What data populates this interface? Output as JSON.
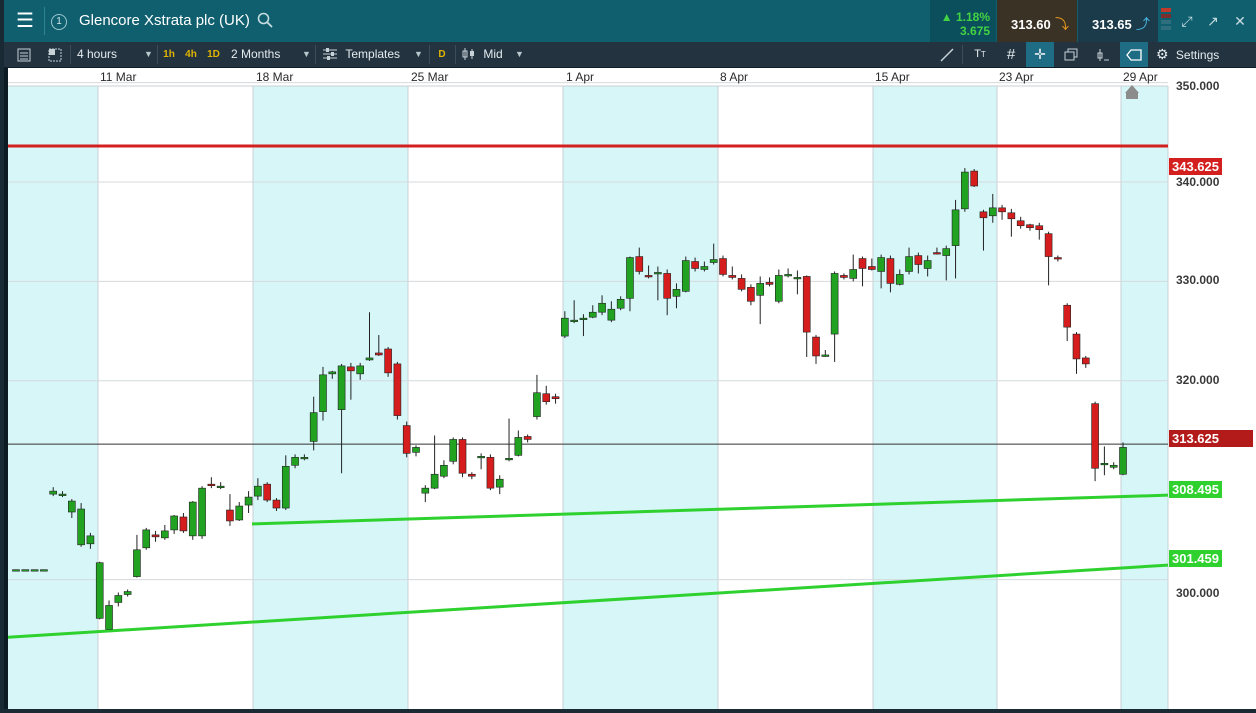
{
  "header": {
    "instrument": "Glencore Xstrata plc (UK)",
    "change_pct": "1.18%",
    "change_abs": "3.675",
    "sell_price": "313.60",
    "buy_price": "313.65",
    "info_badge": "1"
  },
  "toolbar": {
    "interval": "4 hours",
    "tf_1h": "1h",
    "tf_4h": "4h",
    "tf_1d": "1D",
    "range": "2 Months",
    "templates": "Templates",
    "d_label": "D",
    "price_type": "Mid",
    "settings": "Settings"
  },
  "chart": {
    "dates": [
      "11 Mar",
      "18 Mar",
      "25 Mar",
      "1 Apr",
      "8 Apr",
      "15 Apr",
      "23 Apr",
      "29 Apr"
    ],
    "price_ticks": [
      "350.000",
      "340.000",
      "330.000",
      "320.000",
      "300.000"
    ],
    "resistance": "343.625",
    "current": "313.625",
    "support_upper": "308.495",
    "support_lower": "301.459",
    "colors": {
      "up": "#21a321",
      "down": "#d61d1d",
      "shade": "#d6f6f8",
      "resistance": "#d41f1f",
      "support": "#2ed12e"
    }
  },
  "chart_data": {
    "type": "candlestick",
    "x": [
      "11 Mar",
      "18 Mar",
      "25 Mar",
      "1 Apr",
      "8 Apr",
      "15 Apr",
      "23 Apr",
      "29 Apr"
    ],
    "ylim": [
      290,
      352
    ],
    "y_ticks": [
      300,
      320,
      330,
      340,
      350
    ],
    "candles": [
      [
        301,
        301,
        301,
        301
      ],
      [
        301,
        301,
        301,
        301
      ],
      [
        301,
        301,
        301,
        301
      ],
      [
        301,
        301,
        301,
        301
      ],
      [
        308.6,
        308.9,
        309.3,
        308.4
      ],
      [
        308.5,
        308.6,
        308.9,
        308.3
      ],
      [
        306.8,
        307.9,
        308.1,
        306.2
      ],
      [
        303.5,
        307.1,
        307.7,
        303.3
      ],
      [
        303.6,
        304.4,
        304.7,
        303.1
      ],
      [
        296.1,
        301.7,
        301.8,
        296.0
      ],
      [
        295.0,
        297.4,
        297.9,
        295.1
      ],
      [
        297.7,
        298.4,
        298.7,
        297.3
      ],
      [
        298.5,
        298.8,
        299.0,
        298.3
      ],
      [
        300.3,
        303.0,
        304.5,
        300.2
      ],
      [
        303.2,
        305.0,
        305.2,
        303.0
      ],
      [
        304.5,
        304.3,
        304.9,
        303.8
      ],
      [
        304.2,
        304.9,
        305.5,
        304.0
      ],
      [
        305.0,
        306.4,
        306.5,
        304.6
      ],
      [
        306.3,
        304.9,
        306.7,
        304.7
      ],
      [
        304.4,
        307.8,
        307.9,
        304.0
      ],
      [
        304.4,
        309.2,
        309.4,
        304.1
      ],
      [
        309.6,
        309.5,
        310.3,
        309.2
      ],
      [
        309.4,
        309.4,
        309.8,
        309.1
      ],
      [
        307.0,
        305.9,
        308.6,
        305.4
      ],
      [
        306.0,
        307.4,
        307.8,
        305.9
      ],
      [
        307.5,
        308.3,
        308.9,
        306.7
      ],
      [
        308.4,
        309.4,
        310.2,
        308.0
      ],
      [
        309.6,
        308.0,
        309.8,
        307.8
      ],
      [
        308.0,
        307.2,
        308.2,
        306.9
      ],
      [
        307.2,
        311.4,
        312.5,
        307.0
      ],
      [
        311.5,
        312.3,
        312.6,
        311.2
      ],
      [
        312.3,
        312.3,
        312.6,
        312.0
      ],
      [
        313.9,
        316.8,
        318.4,
        313.0
      ],
      [
        316.9,
        320.6,
        321.4,
        316.0
      ],
      [
        320.7,
        320.9,
        321.0,
        320.2
      ],
      [
        317.1,
        321.5,
        321.7,
        310.7
      ],
      [
        321.4,
        321.0,
        321.8,
        318.1
      ],
      [
        320.7,
        321.5,
        321.8,
        320.1
      ],
      [
        322.1,
        322.3,
        326.9,
        322.0
      ],
      [
        322.8,
        322.6,
        324.6,
        322.5
      ],
      [
        323.2,
        320.8,
        323.4,
        320.4
      ],
      [
        321.7,
        316.5,
        321.9,
        316.1
      ],
      [
        315.5,
        312.7,
        315.9,
        312.3
      ],
      [
        312.8,
        313.3,
        313.5,
        312.4
      ],
      [
        308.7,
        309.2,
        309.5,
        307.8
      ],
      [
        309.2,
        310.6,
        314.5,
        309.1
      ],
      [
        310.4,
        311.5,
        312.0,
        310.2
      ],
      [
        311.9,
        314.1,
        314.3,
        311.6
      ],
      [
        314.1,
        310.7,
        314.3,
        310.3
      ],
      [
        310.6,
        310.4,
        310.8,
        310.1
      ],
      [
        312.4,
        312.4,
        312.7,
        311.1
      ],
      [
        312.3,
        309.2,
        312.6,
        309.0
      ],
      [
        309.3,
        310.1,
        310.5,
        308.6
      ],
      [
        312.2,
        312.2,
        316.2,
        311.9
      ],
      [
        312.5,
        314.3,
        315.0,
        312.4
      ],
      [
        314.4,
        314.1,
        314.6,
        313.8
      ],
      [
        316.4,
        318.8,
        320.6,
        316.1
      ],
      [
        318.7,
        317.9,
        319.5,
        317.6
      ],
      [
        318.4,
        318.2,
        318.7,
        317.7
      ],
      [
        324.5,
        326.3,
        327.0,
        324.3
      ],
      [
        326.1,
        326.1,
        328.1,
        325.8
      ],
      [
        326.2,
        326.3,
        326.7,
        324.5
      ],
      [
        326.4,
        326.9,
        327.6,
        326.3
      ],
      [
        326.9,
        327.8,
        328.6,
        326.6
      ],
      [
        326.1,
        327.2,
        328.0,
        325.9
      ],
      [
        327.3,
        328.2,
        328.5,
        327.1
      ],
      [
        328.3,
        332.4,
        332.5,
        327.0
      ],
      [
        332.5,
        331.0,
        333.4,
        330.7
      ],
      [
        330.6,
        330.5,
        331.6,
        330.3
      ],
      [
        330.8,
        330.9,
        331.5,
        328.1
      ],
      [
        330.8,
        328.3,
        331.2,
        326.6
      ],
      [
        328.5,
        329.2,
        329.8,
        327.3
      ],
      [
        329.0,
        332.1,
        332.5,
        328.9
      ],
      [
        332.0,
        331.3,
        332.4,
        331.0
      ],
      [
        331.2,
        331.5,
        332.0,
        331.0
      ],
      [
        331.9,
        332.2,
        333.8,
        331.7
      ],
      [
        332.3,
        330.7,
        332.6,
        330.5
      ],
      [
        330.6,
        330.4,
        331.5,
        330.2
      ],
      [
        330.3,
        329.2,
        330.7,
        329.0
      ],
      [
        329.4,
        328.0,
        329.7,
        327.6
      ],
      [
        328.6,
        329.8,
        330.5,
        325.7
      ],
      [
        329.9,
        329.7,
        330.4,
        329.5
      ],
      [
        328.0,
        330.6,
        331.2,
        327.8
      ],
      [
        330.6,
        330.7,
        331.3,
        330.4
      ],
      [
        330.4,
        330.4,
        331.1,
        328.7
      ],
      [
        330.5,
        324.9,
        330.6,
        322.4
      ],
      [
        324.4,
        322.5,
        324.6,
        321.7
      ],
      [
        322.5,
        322.6,
        323.1,
        322.4
      ],
      [
        324.7,
        330.8,
        331.0,
        321.9
      ],
      [
        330.6,
        330.4,
        330.8,
        330.2
      ],
      [
        330.3,
        331.2,
        332.7,
        330.0
      ],
      [
        332.3,
        331.3,
        332.5,
        329.5
      ],
      [
        331.5,
        331.2,
        332.3,
        331.1
      ],
      [
        331.0,
        332.4,
        332.7,
        329.3
      ],
      [
        332.3,
        329.8,
        332.6,
        328.9
      ],
      [
        329.7,
        330.7,
        331.2,
        329.6
      ],
      [
        331.0,
        332.5,
        333.4,
        330.7
      ],
      [
        332.6,
        331.7,
        332.9,
        330.8
      ],
      [
        331.3,
        332.1,
        332.6,
        330.5
      ],
      [
        332.9,
        332.8,
        333.4,
        332.7
      ],
      [
        332.6,
        333.3,
        333.6,
        330.1
      ],
      [
        333.6,
        337.2,
        338.2,
        330.3
      ],
      [
        337.3,
        341.0,
        341.4,
        337.0
      ],
      [
        341.1,
        339.6,
        341.3,
        339.5
      ],
      [
        337.0,
        336.4,
        337.2,
        333.1
      ],
      [
        336.6,
        337.4,
        338.8,
        335.9
      ],
      [
        337.4,
        337.0,
        337.7,
        336.2
      ],
      [
        336.9,
        336.3,
        337.3,
        334.5
      ],
      [
        336.1,
        335.6,
        336.5,
        335.3
      ],
      [
        335.7,
        335.4,
        335.8,
        335.1
      ],
      [
        335.6,
        335.2,
        335.9,
        334.2
      ],
      [
        334.8,
        332.5,
        335.0,
        329.6
      ],
      [
        332.4,
        332.3,
        332.6,
        332.0
      ],
      [
        327.6,
        325.4,
        327.8,
        324.0
      ],
      [
        324.7,
        322.2,
        324.9,
        320.7
      ],
      [
        322.3,
        321.7,
        322.5,
        321.3
      ],
      [
        317.7,
        311.2,
        317.9,
        309.9
      ],
      [
        311.6,
        311.7,
        313.4,
        310.5
      ],
      [
        311.3,
        311.5,
        311.8,
        311.1
      ],
      [
        310.6,
        313.3,
        313.8,
        310.5
      ]
    ],
    "lines": [
      {
        "label": "343.625",
        "type": "resistance",
        "value": 343.625
      },
      {
        "label": "313.625",
        "type": "current price",
        "value": 313.625
      },
      {
        "label": "308.495",
        "type": "support",
        "value": 308.495
      },
      {
        "label": "301.459",
        "type": "support",
        "value": 301.459
      }
    ]
  }
}
